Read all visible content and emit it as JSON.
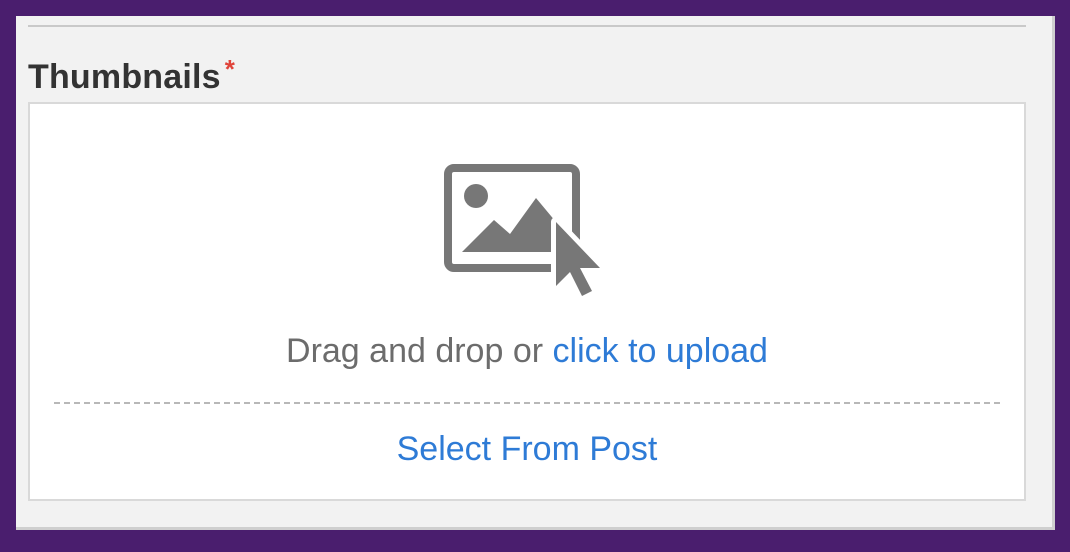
{
  "field": {
    "label": "Thumbnails",
    "required_marker": "*"
  },
  "dropzone": {
    "icon": "image-upload-icon",
    "drop_text": "Drag and drop or ",
    "upload_link": "click to upload",
    "select_from_post": "Select From Post"
  },
  "colors": {
    "background_frame": "#4a1e6e",
    "link": "#2e7bd6",
    "required": "#e0443a",
    "icon": "#777777"
  }
}
